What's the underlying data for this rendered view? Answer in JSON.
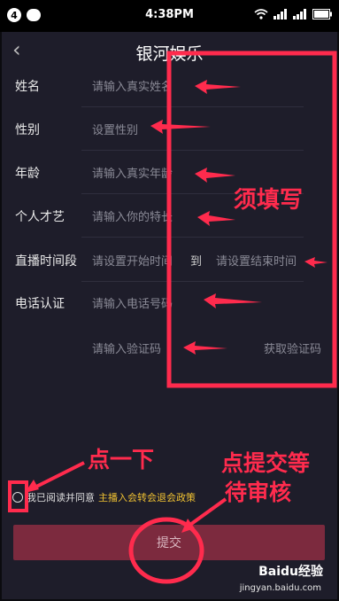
{
  "status_bar": {
    "notification_count": "4",
    "time": "4:38PM"
  },
  "header": {
    "title": "银河娱乐"
  },
  "form": {
    "name": {
      "label": "姓名",
      "placeholder": "请输入真实姓名"
    },
    "gender": {
      "label": "性别",
      "placeholder": "设置性别"
    },
    "age": {
      "label": "年龄",
      "placeholder": "请输入真实年龄"
    },
    "talent": {
      "label": "个人才艺",
      "placeholder": "请输入你的特长"
    },
    "stream_time": {
      "label": "直播时间段",
      "start_placeholder": "请设置开始时间",
      "to": "到",
      "end_placeholder": "请设置结束时间"
    },
    "phone": {
      "label": "电话认证",
      "placeholder": "请输入电话号码"
    },
    "code": {
      "placeholder": "请输入验证码",
      "button": "获取验证码"
    }
  },
  "agreement": {
    "prefix": "我已阅读并同意",
    "link": "主播入会转会退会政策"
  },
  "submit": {
    "label": "提交"
  },
  "annotations": {
    "required": "须填写",
    "click_once": "点一下",
    "submit_wait_line1": "点提交等",
    "submit_wait_line2": "待审核"
  },
  "watermark": {
    "logo": "Baidu经验",
    "url": "jingyan.baidu.com"
  },
  "colors": {
    "background": "#1e1d2a",
    "annotation": "#ff2b4d",
    "submit_bg": "#7c2a3e",
    "link": "#f1c232"
  }
}
